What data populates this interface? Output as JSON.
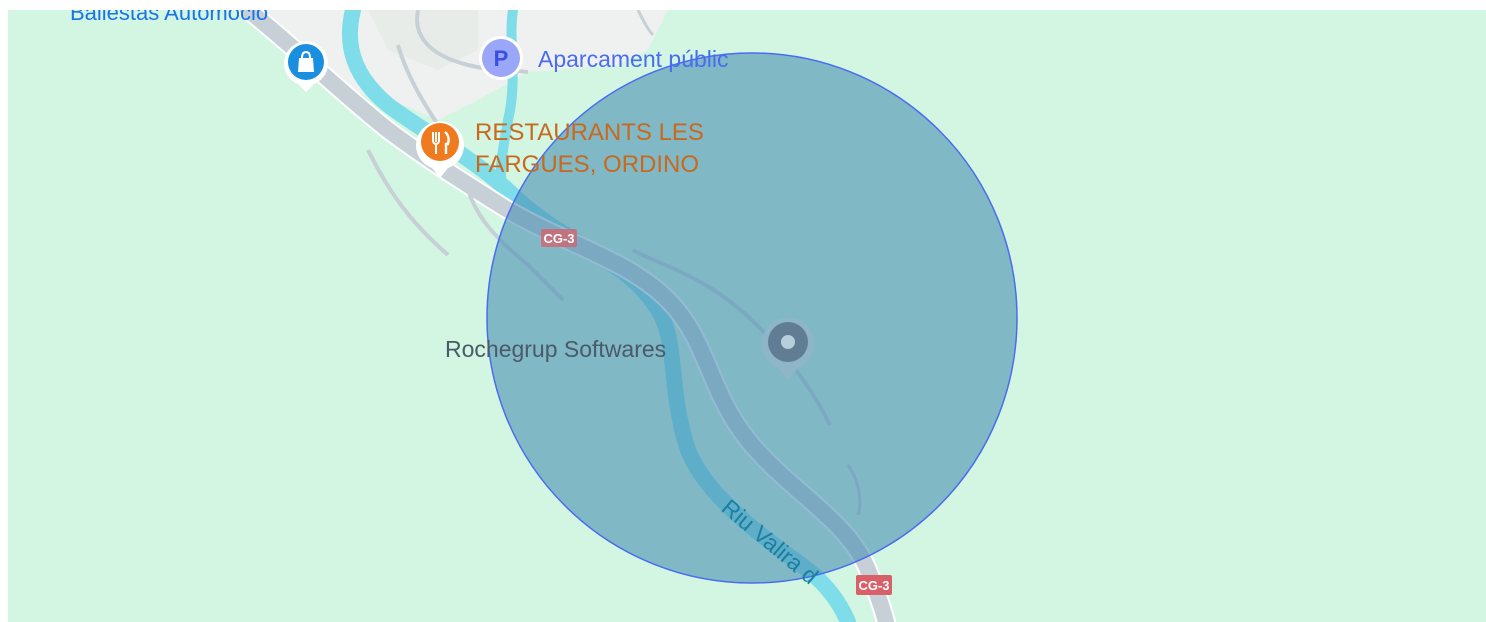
{
  "map": {
    "colors": {
      "land": "#d2f6e1",
      "road": "#c6d0d6",
      "road_edge": "#ffffff",
      "river": "#7fdde9",
      "urban": "#eef1ef",
      "radius_fill": "#4a90b4",
      "radius_stroke": "#4a6cf0",
      "route_badge": "#d86068",
      "shopping": "#1a8fe0",
      "parking": "#6d7cf5",
      "restaurant": "#f07a1e",
      "place_pin": "#607d94"
    },
    "pois": {
      "shop": {
        "label": "Ballestas Automoció",
        "icon": "shopping-bag-icon"
      },
      "parking": {
        "badge": "P",
        "label": "Aparcament públic",
        "icon": "parking-icon"
      },
      "restaurant": {
        "label_line1": "RESTAURANTS LES",
        "label_line2": "FARGUES, ORDINO",
        "icon": "fork-knife-icon"
      },
      "place": {
        "label": "Rochegrup Softwares",
        "icon": "place-pin-icon"
      }
    },
    "roads": {
      "route_label_1": "CG-3",
      "route_label_2": "CG-3"
    },
    "water": {
      "river_label": "Riu Valira d"
    }
  }
}
